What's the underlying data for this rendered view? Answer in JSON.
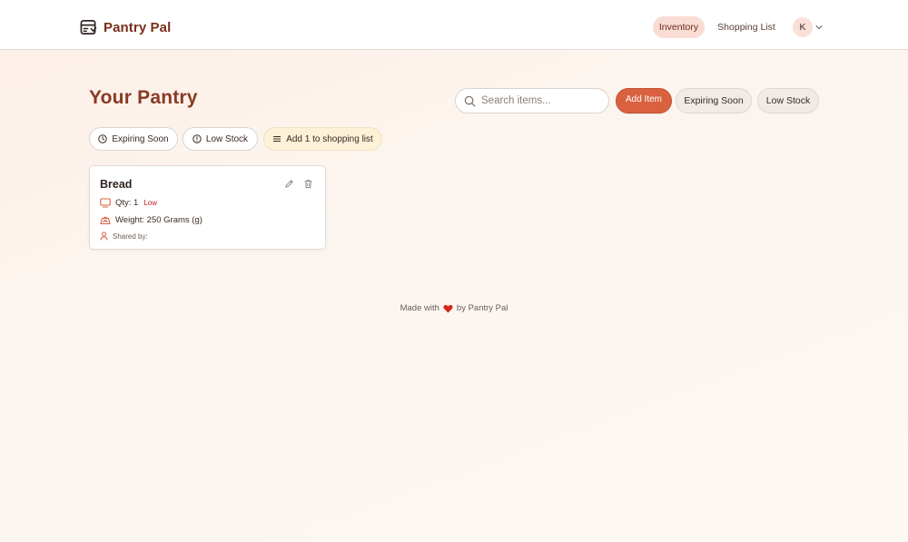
{
  "header": {
    "brand_name": "Pantry Pal",
    "nav": {
      "inventory": "Inventory",
      "shopping_list": "Shopping List"
    },
    "avatar_initial": "K"
  },
  "main": {
    "title": "Your Pantry",
    "search": {
      "placeholder": "Search items...",
      "value": ""
    },
    "actions": {
      "add_item": "Add Item",
      "expiring_soon": "Expiring Soon",
      "low_stock": "Low Stock"
    },
    "chips": {
      "expiring_soon": "Expiring Soon",
      "low_stock": "Low Stock",
      "add_to_list": "Add 1 to shopping list"
    },
    "items": [
      {
        "name": "Bread",
        "qty_text": "Qty: 1",
        "qty_badge": "Low",
        "weight_text": "Weight: 250 Grams (g)",
        "shared_text": "Shared by:"
      }
    ]
  },
  "footer": {
    "prefix": "Made with",
    "suffix": "by Pantry Pal"
  },
  "colors": {
    "accent": "#d9613f",
    "brand": "#7a2e1a",
    "title": "#8a3a24",
    "low_badge": "#c02020"
  }
}
